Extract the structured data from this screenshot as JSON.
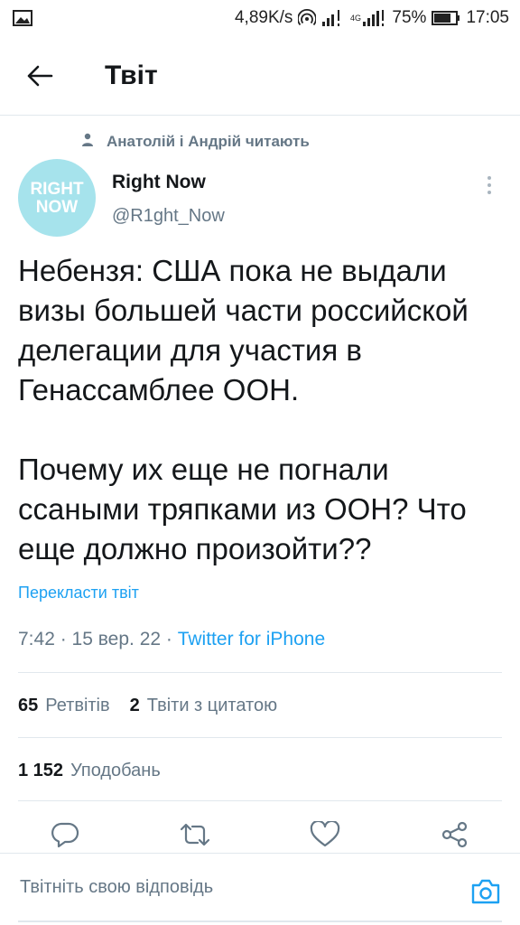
{
  "status_bar": {
    "speed": "4,89K/s",
    "network": "4G",
    "battery": "75%",
    "time": "17:05"
  },
  "header": {
    "title": "Твіт"
  },
  "social_context": "Анатолій і Андрій читають",
  "tweet": {
    "avatar_text": [
      "RIGHT",
      "NOW"
    ],
    "author_name": "Right Now",
    "author_handle": "@R1ght_Now",
    "text": "Небензя: США пока не выдали визы большей части российской делегации для участия в Генассамблее ООН.\n\nПочему их еще не погнали ссаными тряпками из ООН? Что еще должно произойти??",
    "translate_label": "Перекласти твіт",
    "time": "7:42",
    "date": "15 вер. 22",
    "source": "Twitter for iPhone",
    "retweets_count": "65",
    "retweets_label": "Ретвітів",
    "quotes_count": "2",
    "quotes_label": "Твіти з цитатою",
    "likes_count": "1 152",
    "likes_label": "Уподобань"
  },
  "reply": {
    "placeholder": "Твітніть свою відповідь"
  },
  "colors": {
    "accent": "#1da1f2",
    "muted": "#657786",
    "avatar_bg": "#a6e3ec"
  }
}
